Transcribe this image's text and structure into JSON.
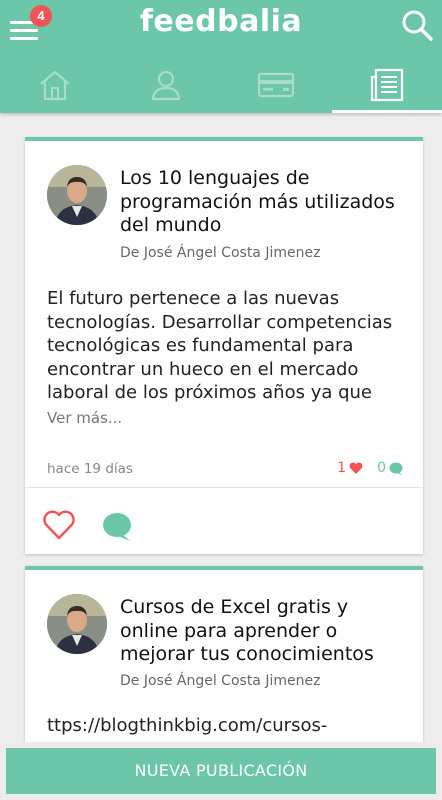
{
  "header": {
    "logo": "feedbalia",
    "notification_count": "4"
  },
  "tabs": [
    {
      "name": "home-icon",
      "active": false
    },
    {
      "name": "user-icon",
      "active": false
    },
    {
      "name": "card-icon",
      "active": false
    },
    {
      "name": "news-icon",
      "active": true
    }
  ],
  "posts": [
    {
      "title": "Los 10 lenguajes de programación más utilizados del mundo",
      "author": "De José Ángel Costa Jimenez",
      "body": "El futuro pertenece a las nuevas tecnologías. Desarrollar competencias tecnológicas es fundamental para encontrar un hueco en el mercado laboral de los próximos años ya que",
      "more": "Ver más...",
      "time": "hace 19 días",
      "likes": "1",
      "comments": "0"
    },
    {
      "title": "Cursos de Excel gratis y online para aprender o mejorar tus conocimientos",
      "author": "De José Ángel Costa Jimenez",
      "body": "ttps://blogthinkbig.com/cursos-"
    }
  ],
  "footer": {
    "new_post_label": "NUEVA PUBLICACIÓN"
  },
  "colors": {
    "accent": "#6cc6a9",
    "like": "#f05454",
    "badge": "#f05454"
  }
}
